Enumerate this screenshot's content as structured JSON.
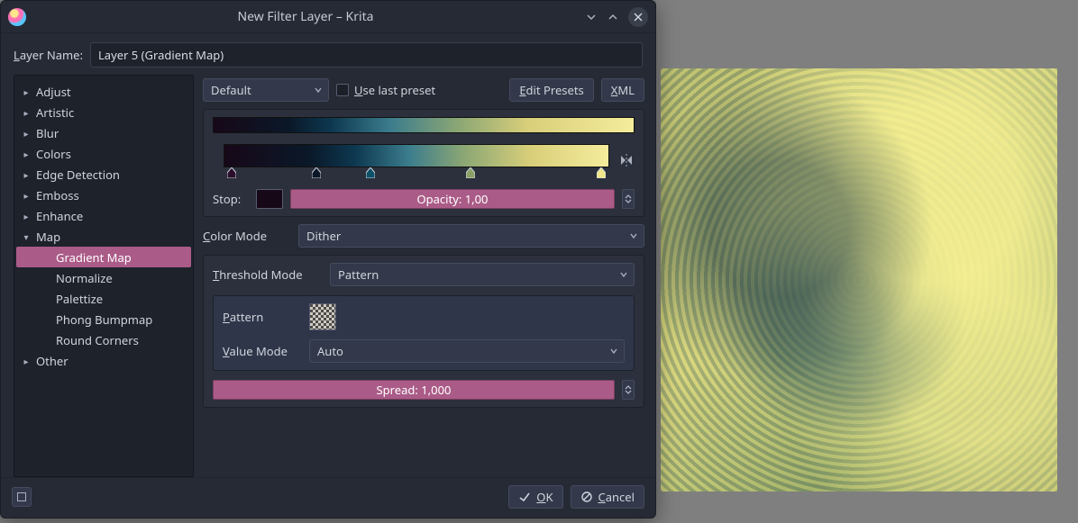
{
  "window": {
    "title": "New Filter Layer – Krita"
  },
  "layer_name": {
    "label_prefix": "L",
    "label_rest": "ayer Name:",
    "value": "Layer 5 (Gradient Map)"
  },
  "tree": {
    "items": [
      {
        "label": "Adjust",
        "expanded": false
      },
      {
        "label": "Artistic",
        "expanded": false
      },
      {
        "label": "Blur",
        "expanded": false
      },
      {
        "label": "Colors",
        "expanded": false
      },
      {
        "label": "Edge Detection",
        "expanded": false
      },
      {
        "label": "Emboss",
        "expanded": false
      },
      {
        "label": "Enhance",
        "expanded": false
      },
      {
        "label": "Map",
        "expanded": true,
        "children": [
          {
            "label": "Gradient Map",
            "selected": true
          },
          {
            "label": "Normalize"
          },
          {
            "label": "Palettize"
          },
          {
            "label": "Phong Bumpmap"
          },
          {
            "label": "Round Corners"
          }
        ]
      },
      {
        "label": "Other",
        "expanded": false
      }
    ]
  },
  "toolbar": {
    "preset_dropdown": "Default",
    "use_last_preset_prefix": "U",
    "use_last_preset_rest": "se last preset",
    "edit_presets_prefix": "E",
    "edit_presets_rest": "dit Presets",
    "xml_prefix": "X",
    "xml_rest": "ML"
  },
  "gradient": {
    "stops": [
      {
        "pos": 2,
        "color": "#2a0e2c"
      },
      {
        "pos": 24,
        "color": "#0a1828"
      },
      {
        "pos": 38,
        "color": "#0d5068"
      },
      {
        "pos": 64,
        "color": "#8aa066"
      },
      {
        "pos": 98,
        "color": "#f0e68a"
      }
    ],
    "stop_label": "Stop:",
    "opacity_label": "Opacity: 1,00",
    "selected_stop_color": "#170818"
  },
  "color_mode": {
    "label_prefix": "C",
    "label_rest": "olor Mode",
    "value": "Dither"
  },
  "threshold": {
    "label_prefix": "T",
    "label_rest": "hreshold Mode",
    "value": "Pattern",
    "pattern_label_prefix": "P",
    "pattern_label_rest": "attern",
    "value_mode_label_prefix": "V",
    "value_mode_label_rest": "alue Mode",
    "value_mode": "Auto",
    "spread_label": "Spread:  1,000"
  },
  "footer": {
    "ok_prefix": "O",
    "ok_rest": "K",
    "cancel_prefix": "C",
    "cancel_rest": "ancel"
  }
}
